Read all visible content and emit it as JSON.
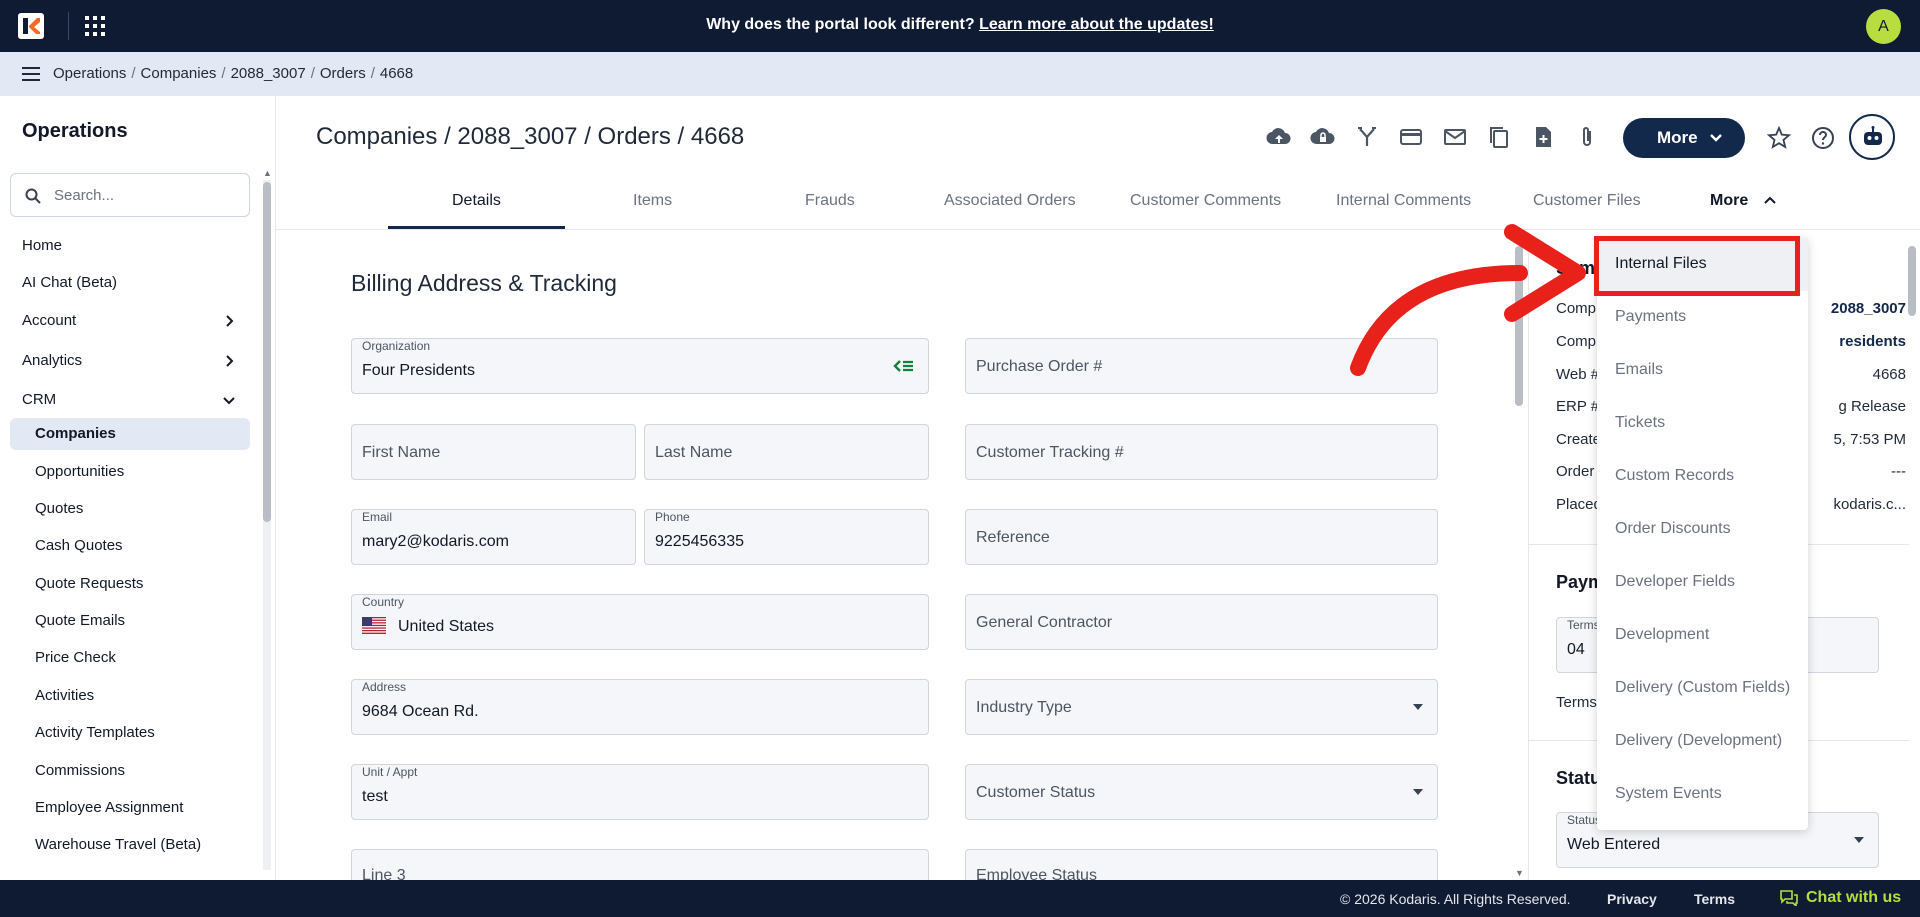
{
  "topbar": {
    "announcement_text": "Why does the portal look different?",
    "announcement_link": "Learn more about the updates!",
    "avatar_initial": "A"
  },
  "breadcrumb": [
    "Operations",
    "Companies",
    "2088_3007",
    "Orders",
    "4668"
  ],
  "sidebar": {
    "title": "Operations",
    "search_placeholder": "Search...",
    "items": [
      {
        "label": "Home",
        "sub": false
      },
      {
        "label": "AI Chat (Beta)",
        "sub": false
      },
      {
        "label": "Account",
        "sub": false,
        "chevron": "right"
      },
      {
        "label": "Analytics",
        "sub": false,
        "chevron": "right"
      },
      {
        "label": "CRM",
        "sub": false,
        "chevron": "down"
      },
      {
        "label": "Companies",
        "sub": true,
        "active": true
      },
      {
        "label": "Opportunities",
        "sub": true
      },
      {
        "label": "Quotes",
        "sub": true
      },
      {
        "label": "Cash Quotes",
        "sub": true
      },
      {
        "label": "Quote Requests",
        "sub": true
      },
      {
        "label": "Quote Emails",
        "sub": true
      },
      {
        "label": "Price Check",
        "sub": true
      },
      {
        "label": "Activities",
        "sub": true
      },
      {
        "label": "Activity Templates",
        "sub": true
      },
      {
        "label": "Commissions",
        "sub": true
      },
      {
        "label": "Employee Assignment",
        "sub": true
      },
      {
        "label": "Warehouse Travel (Beta)",
        "sub": true
      }
    ]
  },
  "header": {
    "title": "Companies / 2088_3007 / Orders / 4668",
    "toolbar_icons": [
      "cloud-upload-icon",
      "cloud-lock-icon",
      "merge-icon",
      "credit-card-icon",
      "mail-icon",
      "copy-icon",
      "file-add-icon",
      "paperclip-icon"
    ],
    "more_label": "More"
  },
  "tabs": {
    "items": [
      "Details",
      "Items",
      "Frauds",
      "Associated Orders",
      "Customer Comments",
      "Internal Comments",
      "Customer Files"
    ],
    "active": "Details",
    "more_label": "More"
  },
  "form": {
    "section_title": "Billing Address & Tracking",
    "organization": {
      "label": "Organization",
      "value": "Four Presidents"
    },
    "purchase_order": {
      "placeholder": "Purchase Order #"
    },
    "first_name": {
      "placeholder": "First Name"
    },
    "last_name": {
      "placeholder": "Last Name"
    },
    "customer_tracking": {
      "placeholder": "Customer Tracking #"
    },
    "email": {
      "label": "Email",
      "value": "mary2@kodaris.com"
    },
    "phone": {
      "label": "Phone",
      "value": "9225456335"
    },
    "reference": {
      "placeholder": "Reference"
    },
    "country": {
      "label": "Country",
      "value": "United States"
    },
    "general_contractor": {
      "placeholder": "General Contractor"
    },
    "address": {
      "label": "Address",
      "value": "9684 Ocean Rd."
    },
    "industry_type": {
      "placeholder": "Industry Type"
    },
    "unit": {
      "label": "Unit / Appt",
      "value": "test"
    },
    "customer_status": {
      "placeholder": "Customer Status"
    },
    "line3": {
      "placeholder": "Line 3"
    },
    "employee_status": {
      "placeholder": "Employee Status"
    }
  },
  "summary": {
    "heading_partial": "Sum",
    "rows": [
      {
        "label": "Comp",
        "value": "2088_3007",
        "link": true
      },
      {
        "label": "Comp",
        "value": "residents",
        "link": true
      },
      {
        "label": "Web #",
        "value": "4668"
      },
      {
        "label": "ERP #",
        "value": "g Release"
      },
      {
        "label": "Create",
        "value": "5, 7:53 PM"
      },
      {
        "label": "Order",
        "value": "---"
      },
      {
        "label": "Placed",
        "value": "kodaris.c..."
      }
    ],
    "payment_heading": "Paym",
    "terms_label": "Terms",
    "terms_value": "04",
    "terms_text": "Terms",
    "status_heading": "Statu",
    "status_label": "Status",
    "status_value": "Web Entered"
  },
  "more_menu": {
    "items": [
      "Internal Files",
      "Payments",
      "Emails",
      "Tickets",
      "Custom Records",
      "Order Discounts",
      "Developer Fields",
      "Development",
      "Delivery (Custom Fields)",
      "Delivery (Development)",
      "System Events"
    ],
    "highlighted": "Internal Files"
  },
  "footer": {
    "copyright": "© 2026 Kodaris. All Rights Reserved.",
    "privacy": "Privacy",
    "terms": "Terms",
    "chat": "Chat with us"
  },
  "colors": {
    "navy": "#0f1a33",
    "button_navy": "#13294b",
    "accent_lime": "#b7dd3f",
    "annotation_red": "#e8211b"
  }
}
